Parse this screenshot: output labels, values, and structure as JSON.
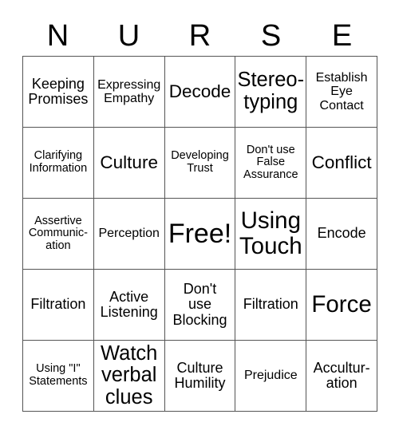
{
  "card": {
    "title_letters": [
      "N",
      "U",
      "R",
      "S",
      "E"
    ],
    "free_space_label": "Free!",
    "grid": [
      [
        {
          "text": "Keeping\nPromises",
          "size": "m"
        },
        {
          "text": "Expressing\nEmpathy",
          "size": "s"
        },
        {
          "text": "Decode",
          "size": "l"
        },
        {
          "text": "Stereo-\ntyping",
          "size": "xl"
        },
        {
          "text": "Establish\nEye\nContact",
          "size": "s"
        }
      ],
      [
        {
          "text": "Clarifying\nInformation",
          "size": "xs"
        },
        {
          "text": "Culture",
          "size": "l"
        },
        {
          "text": "Developing\nTrust",
          "size": "xs"
        },
        {
          "text": "Don't use\nFalse\nAssurance",
          "size": "xs"
        },
        {
          "text": "Conflict",
          "size": "l"
        }
      ],
      [
        {
          "text": "Assertive\nCommunic-\nation",
          "size": "xs"
        },
        {
          "text": "Perception",
          "size": "s"
        },
        {
          "text": "Free!",
          "size": "free"
        },
        {
          "text": "Using\nTouch",
          "size": "xxl"
        },
        {
          "text": "Encode",
          "size": "m"
        }
      ],
      [
        {
          "text": "Filtration",
          "size": "m"
        },
        {
          "text": "Active\nListening",
          "size": "m"
        },
        {
          "text": "Don't\nuse\nBlocking",
          "size": "m"
        },
        {
          "text": "Filtration",
          "size": "m"
        },
        {
          "text": "Force",
          "size": "xxl"
        }
      ],
      [
        {
          "text": "Using \"I\"\nStatements",
          "size": "xs"
        },
        {
          "text": "Watch\nverbal\nclues",
          "size": "xl"
        },
        {
          "text": "Culture\nHumility",
          "size": "m"
        },
        {
          "text": "Prejudice",
          "size": "s"
        },
        {
          "text": "Accultur-\nation",
          "size": "m"
        }
      ]
    ]
  },
  "colors": {
    "background": "#ffffff",
    "text": "#000000",
    "grid_line": "#555555"
  }
}
